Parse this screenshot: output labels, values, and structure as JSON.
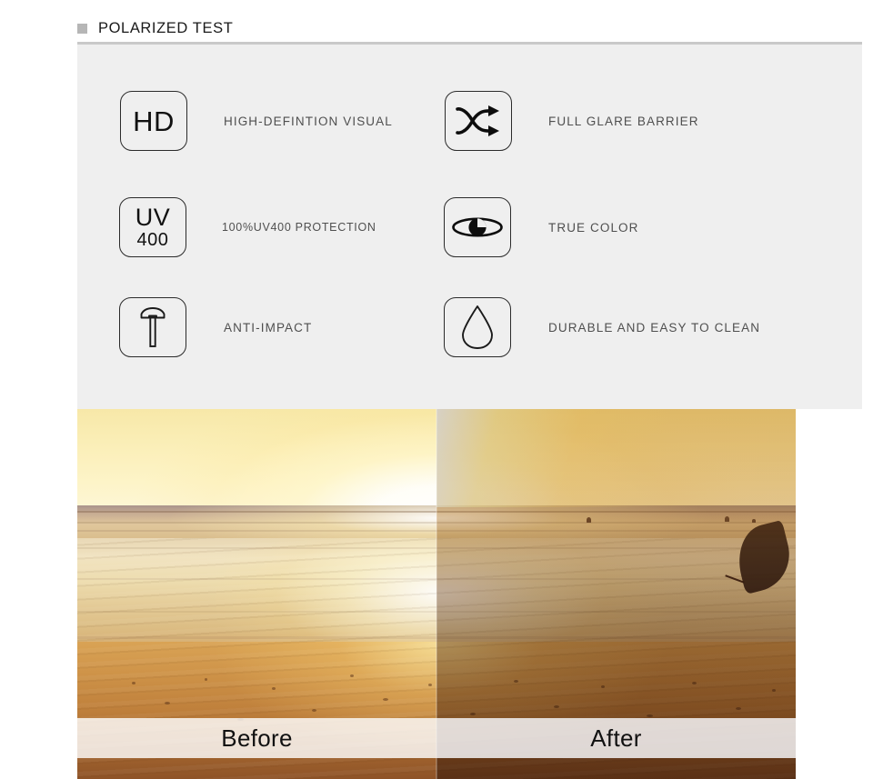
{
  "header": {
    "title": "POLARIZED TEST",
    "bullet_icon": "square-bullet-icon"
  },
  "features": {
    "items": [
      {
        "icon": "hd-text-icon",
        "icon_text": "HD",
        "label": "HIGH-DEFINTION VISUAL"
      },
      {
        "icon": "shuffle-arrows-icon",
        "icon_text": "",
        "label": "FULL GLARE BARRIER"
      },
      {
        "icon": "uv400-text-icon",
        "icon_text_top": "UV",
        "icon_text_bottom": "400",
        "label": "100%UV400 PROTECTION"
      },
      {
        "icon": "eye-icon",
        "icon_text": "",
        "label": "TRUE COLOR"
      },
      {
        "icon": "hammer-icon",
        "icon_text": "",
        "label": "ANTI-IMPACT"
      },
      {
        "icon": "water-droplet-icon",
        "icon_text": "",
        "label": "DURABLE AND EASY TO CLEAN"
      }
    ]
  },
  "comparison": {
    "before_label": "Before",
    "after_label": "After",
    "scene": "beach-sunset-photo"
  },
  "colors": {
    "panel_background": "#efefef",
    "page_background": "#ffffff",
    "rule": "#c9c9c9",
    "bullet": "#b6b6b6",
    "title_text": "#1a1a1a",
    "label_text": "#4f4f4f",
    "icon_outline": "#2b2b2b"
  }
}
